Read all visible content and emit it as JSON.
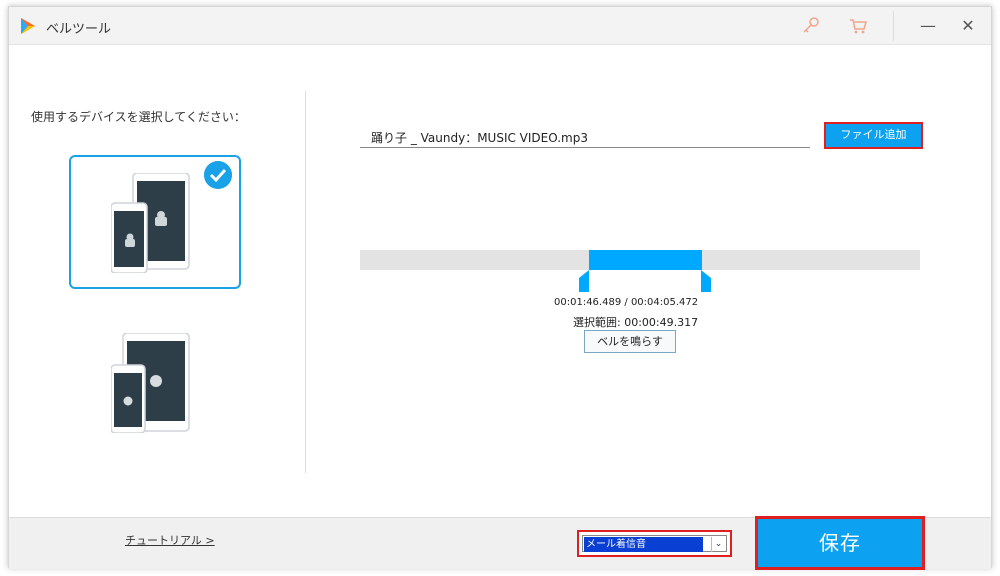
{
  "app": {
    "title": "ベルツール"
  },
  "left_panel": {
    "prompt": "使用するデバイスを選択してください："
  },
  "file": {
    "name": "踊り子 _ Vaundy：MUSIC VIDEO.mp3",
    "add_button_label": "ファイル追加"
  },
  "player": {
    "current_time": "00:01:46.489",
    "total_time": "00:04:05.472",
    "time_separator": "/",
    "selection_label": "選択範囲:",
    "selection_value": "00:00:49.317",
    "ring_button_label": "ベルを鳴らす",
    "selection_start_fraction": 0.41,
    "selection_end_fraction": 0.61
  },
  "footer": {
    "tutorial_link": "チュートリアル >",
    "ringtone_select": {
      "selected": "メール着信音"
    },
    "save_label": "保存"
  },
  "colors": {
    "accent": "#0da1f1",
    "highlight_border": "#e02020",
    "track": "#e3e3e3"
  },
  "icons": [
    "app-logo-icon",
    "key-icon",
    "cart-icon",
    "minimize-icon",
    "close-icon",
    "check-icon",
    "android-icon",
    "apple-icon",
    "chevron-down-icon"
  ]
}
